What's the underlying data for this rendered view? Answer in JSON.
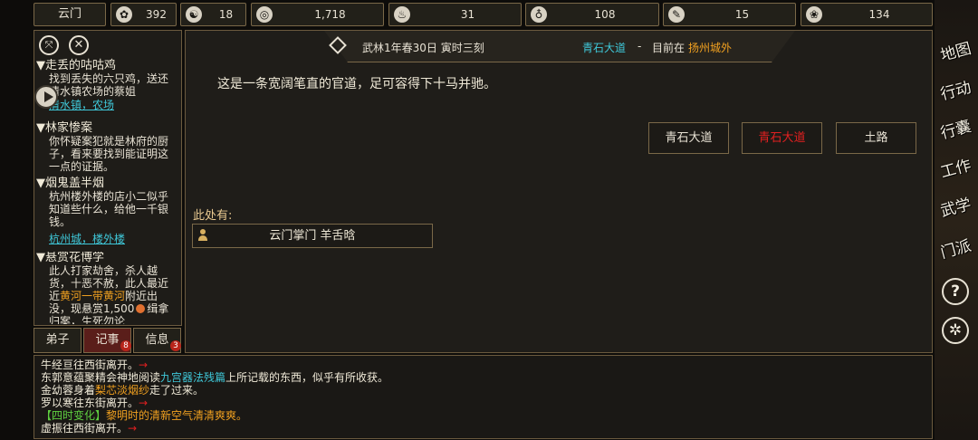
{
  "topbar": {
    "sect_name": "云门",
    "stats": [
      {
        "icon": "coin-pouch-icon",
        "glyph": "✿",
        "value": "392"
      },
      {
        "icon": "yin-yang-icon",
        "glyph": "☯",
        "value": "18"
      },
      {
        "icon": "copper-coin-icon",
        "glyph": "◎",
        "value": "1,718"
      },
      {
        "icon": "food-bowl-icon",
        "glyph": "♨",
        "value": "31"
      },
      {
        "icon": "gourd-icon",
        "glyph": "♁",
        "value": "108"
      },
      {
        "icon": "scroll-icon",
        "glyph": "✎",
        "value": "15"
      },
      {
        "icon": "crowd-icon",
        "glyph": "❀",
        "value": "134"
      }
    ]
  },
  "sidebar": {
    "quests": [
      {
        "title": "▼走丢的咕咕鸡",
        "lines": [
          "找到丢失的六只鸡，送还",
          "清水镇农场的蔡姐"
        ],
        "link": "清水镇，农场"
      },
      {
        "title": "▼林家惨案",
        "lines": [
          "你怀疑案犯就是林府的厨",
          "子，看来要找到能证明这",
          "一点的证据。"
        ],
        "link": ""
      },
      {
        "title": "▼烟鬼盖半烟",
        "lines": [
          "杭州楼外楼的店小二似乎",
          "知道些什么，给他一千银",
          "钱。"
        ],
        "link": "杭州城，楼外楼"
      },
      {
        "title": "▼悬赏花博学",
        "line1": "此人打家劫舍，杀人越",
        "line2": "货，十恶不赦，此人最近",
        "line3_a": "近",
        "line3_hl": "黄河一带黄河",
        "line3_b": "附近出",
        "line4": "没，现悬赏1,500",
        "line4_b": "缉拿",
        "line5": "归案，生死勿论"
      }
    ],
    "tabs": [
      {
        "label": "弟子",
        "badge": ""
      },
      {
        "label": "记事",
        "badge": "8"
      },
      {
        "label": "信息",
        "badge": "3"
      }
    ]
  },
  "header": {
    "date": "武林1年春30日 寅时三刻",
    "road": "青石大道",
    "sep": "-",
    "loc_prefix": "目前在",
    "city": "扬州城外"
  },
  "main": {
    "description": "这是一条宽阔笔直的官道，足可容得下十马并驰。",
    "exits": [
      {
        "label": "青石大道",
        "current": false
      },
      {
        "label": "青石大道",
        "current": true
      },
      {
        "label": "土路",
        "current": false
      }
    ],
    "here_label": "此处有:",
    "npc": "云门掌门 羊舌晗"
  },
  "log": [
    {
      "text": "牛经亘往西街离开。",
      "arrow": "→"
    },
    {
      "pre": "东郭意蕴聚精会神地阅读",
      "book": "九宫器法残篇",
      "post": "上所记载的东西，似乎有所收获。"
    },
    {
      "pre": "金幼蓉身着",
      "item": "梨芯淡烟纱",
      "post": "走了过来。"
    },
    {
      "text": "罗以寒往东街离开。",
      "arrow": "→"
    },
    {
      "tag": "【四时变化】",
      "msg": "黎明时的清新空气清清爽爽。"
    },
    {
      "text": "虚振往西街离开。",
      "arrow": "→"
    }
  ],
  "rightnav": [
    {
      "label": "地图",
      "icon": ""
    },
    {
      "label": "行动",
      "icon": ""
    },
    {
      "label": "行囊",
      "icon": ""
    },
    {
      "label": "工作",
      "icon": ""
    },
    {
      "label": "武学",
      "icon": ""
    },
    {
      "label": "门派",
      "icon": ""
    },
    {
      "label": "?",
      "icon": "help-icon"
    },
    {
      "label": "✲",
      "icon": "settings-icon"
    }
  ],
  "colors": {
    "accent_red": "#e02020",
    "link_cyan": "#3fc7d8",
    "gold": "#f0a020",
    "border": "#7a6848"
  }
}
